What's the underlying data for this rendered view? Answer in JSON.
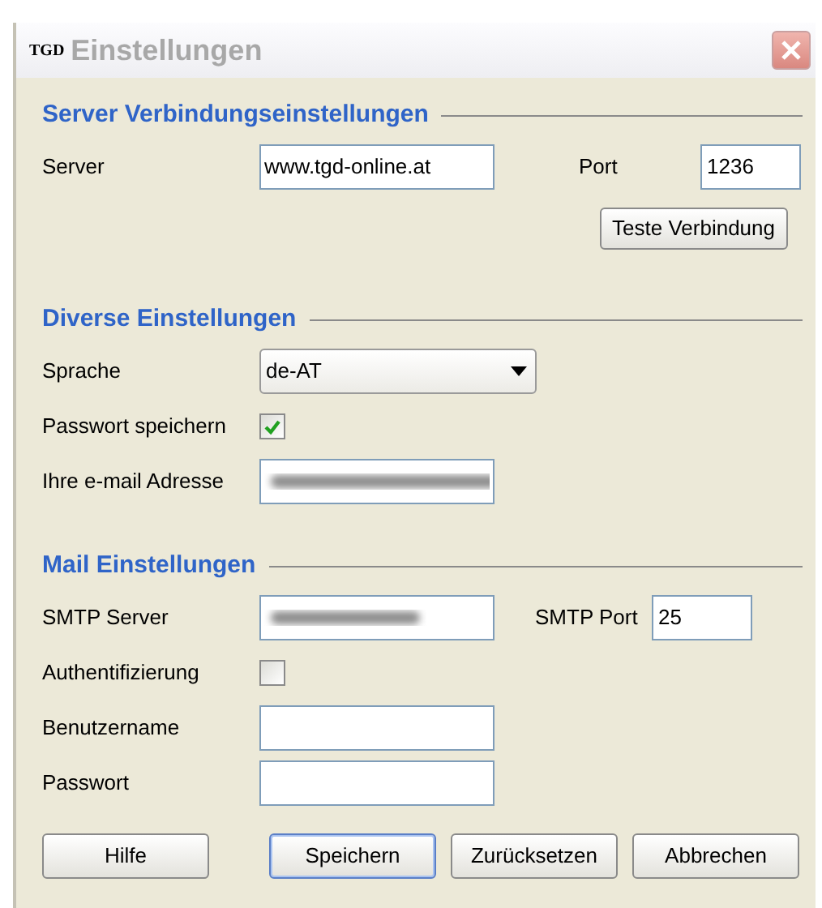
{
  "window": {
    "logo": "TGD",
    "title": "Einstellungen",
    "active": false
  },
  "sections": [
    {
      "title": "Server Verbindungseinstellungen",
      "rows": [
        {
          "kind": "field",
          "label": "Server",
          "value": "www.tgd-online.at",
          "extra": {
            "label": "Port",
            "value": "1236"
          }
        },
        {
          "kind": "button",
          "button": "Teste Verbindung"
        }
      ]
    },
    {
      "title": "Diverse Einstellungen",
      "rows": [
        {
          "kind": "dropdown",
          "label": "Sprache",
          "value": "de-AT"
        },
        {
          "kind": "checkbox",
          "label": "Passwort speichern",
          "checked": true
        },
        {
          "kind": "field",
          "label": "Ihre e-mail Adresse",
          "blurred": true
        }
      ]
    },
    {
      "title": "Mail Einstellungen",
      "rows": [
        {
          "kind": "field",
          "label": "SMTP Server",
          "blurred": true,
          "extra": {
            "label": "SMTP Port",
            "value": "25"
          }
        },
        {
          "kind": "checkbox",
          "label": "Authentifizierung",
          "checked": false
        },
        {
          "kind": "field",
          "label": "Benutzername",
          "value": ""
        },
        {
          "kind": "field",
          "label": "Passwort",
          "value": ""
        }
      ]
    }
  ],
  "buttons": [
    {
      "label": "Hilfe",
      "default": false
    },
    {
      "label": "Speichern",
      "default": true
    },
    {
      "label": "Zurücksetzen",
      "default": false
    },
    {
      "label": "Abbrechen",
      "default": false
    }
  ]
}
